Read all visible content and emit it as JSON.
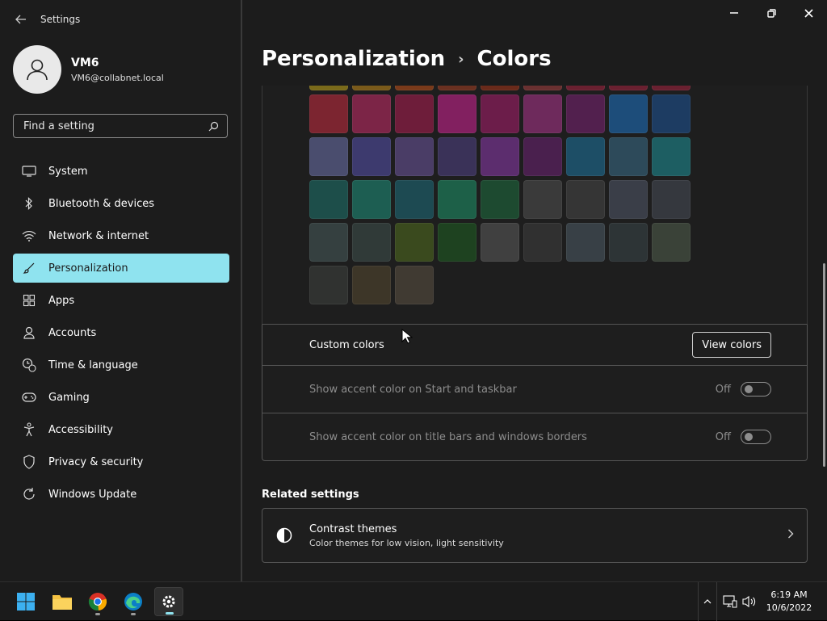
{
  "app": {
    "title": "Settings"
  },
  "user": {
    "name": "VM6",
    "email": "VM6@collabnet.local"
  },
  "search": {
    "placeholder": "Find a setting"
  },
  "sidebar": {
    "items": [
      {
        "label": "System",
        "icon": "monitor-icon"
      },
      {
        "label": "Bluetooth & devices",
        "icon": "bluetooth-icon"
      },
      {
        "label": "Network & internet",
        "icon": "wifi-icon"
      },
      {
        "label": "Personalization",
        "icon": "brush-icon",
        "active": true
      },
      {
        "label": "Apps",
        "icon": "apps-icon"
      },
      {
        "label": "Accounts",
        "icon": "person-icon"
      },
      {
        "label": "Time & language",
        "icon": "clock-globe-icon"
      },
      {
        "label": "Gaming",
        "icon": "gamepad-icon"
      },
      {
        "label": "Accessibility",
        "icon": "accessibility-icon"
      },
      {
        "label": "Privacy & security",
        "icon": "shield-icon"
      },
      {
        "label": "Windows Update",
        "icon": "refresh-icon"
      }
    ]
  },
  "header": {
    "parent": "Personalization",
    "separator": "›",
    "current": "Colors"
  },
  "palette": {
    "colors_row0": [
      "#7a6a1a",
      "#7a5a1a",
      "#7a3a1a",
      "#6a3020",
      "#6a2a1a",
      "#6a3030",
      "#6a2030",
      "#6a2030",
      "#6a2030"
    ],
    "colors": [
      [
        "#7c2530",
        "#7c2547",
        "#6e1d3a",
        "#822060",
        "#6c1d4a",
        "#6e2a5c",
        "#52204e",
        "#1d4d7a",
        "#1d3c62"
      ],
      [
        "#4a4d6e",
        "#3d3a6e",
        "#4a3d66",
        "#3a3258",
        "#5c2d6e",
        "#4a204e",
        "#1d4e66",
        "#2d4a5a",
        "#1d5e62"
      ],
      [
        "#1d4e4a",
        "#1d5e52",
        "#1d4a52",
        "#1d6048",
        "#1d4a30",
        "#3a3a3a",
        "#353535",
        "#3a3e48",
        "#35383e"
      ],
      [
        "#354040",
        "#303a38",
        "#3a4a1e",
        "#1e4220",
        "#404040",
        "#303030",
        "#384046",
        "#2d3436",
        "#3a4238"
      ],
      [
        "#303230",
        "#3d3628",
        "#403a32"
      ]
    ]
  },
  "custom_colors": {
    "label": "Custom colors",
    "button": "View colors"
  },
  "accent_start": {
    "label": "Show accent color on Start and taskbar",
    "state": "Off"
  },
  "accent_title": {
    "label": "Show accent color on title bars and windows borders",
    "state": "Off"
  },
  "related": {
    "heading": "Related settings",
    "contrast": {
      "title": "Contrast themes",
      "subtitle": "Color themes for low vision, light sensitivity"
    }
  },
  "taskbar": {
    "apps": [
      "windows-start-icon",
      "file-explorer-icon",
      "chrome-icon",
      "edge-icon",
      "settings-icon"
    ],
    "time": "6:19 AM",
    "date": "10/6/2022"
  },
  "colors": {
    "accent": "#8fe3ef",
    "background": "#1c1c1c"
  }
}
